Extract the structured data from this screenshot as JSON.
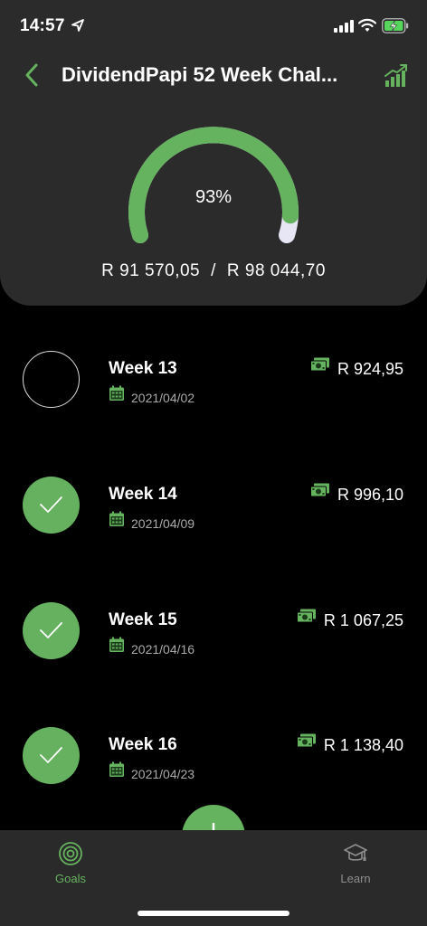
{
  "status": {
    "time": "14:57"
  },
  "header": {
    "title": "DividendPapi 52 Week Chal...",
    "progress_percent": 93,
    "progress_label": "93%",
    "saved_amount": "R 91 570,05",
    "separator": "/",
    "target_amount": "R 98 044,70"
  },
  "weeks": [
    {
      "label": "Week 13",
      "date": "2021/04/02",
      "amount": "R 924,95",
      "done": false
    },
    {
      "label": "Week 14",
      "date": "2021/04/09",
      "amount": "R 996,10",
      "done": true
    },
    {
      "label": "Week 15",
      "date": "2021/04/16",
      "amount": "R 1 067,25",
      "done": true
    },
    {
      "label": "Week 16",
      "date": "2021/04/23",
      "amount": "R 1 138,40",
      "done": true
    }
  ],
  "tabs": {
    "goals": "Goals",
    "learn": "Learn"
  },
  "colors": {
    "accent": "#66b35f",
    "card": "#2b2b2b",
    "tabbar": "#2a2a2a"
  }
}
